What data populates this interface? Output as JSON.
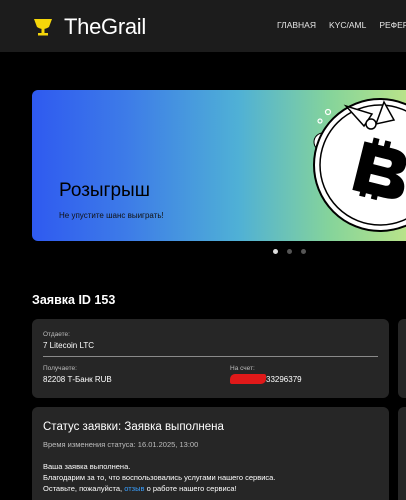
{
  "header": {
    "brand": "TheGrail",
    "nav": [
      "ГЛАВНАЯ",
      "KYC/AML",
      "РЕФЕРАЛ"
    ]
  },
  "banner": {
    "title": "Розыгрыш",
    "subtitle": "Не упустите шанс выиграть!",
    "slides_total": 3,
    "active_slide": 1
  },
  "order": {
    "title": "Заявка ID 153",
    "give_label": "Отдаете:",
    "give_value": "7 Litecoin LTC",
    "receive_label": "Получаете:",
    "receive_value": "82208 Т-Банк RUB",
    "account_label": "На счет:",
    "account_value_visible": "33296379"
  },
  "status": {
    "title": "Статус заявки: Заявка выполнена",
    "changed_time": "Время изменения статуса: 16.01.2025, 13:00",
    "line1": "Ваша заявка выполнена.",
    "line2": "Благодарим за то, что воспользовались услугами нашего сервиса.",
    "line3_pre": "Оставьте, пожалуйста,",
    "line3_link": "отзыв",
    "line3_post": "о работе нашего сервиса!"
  },
  "colors": {
    "header_bg": "#1c1c1c",
    "card_bg": "#262626",
    "link": "#3aa0ff",
    "logo_yellow": "#f5d60a"
  }
}
